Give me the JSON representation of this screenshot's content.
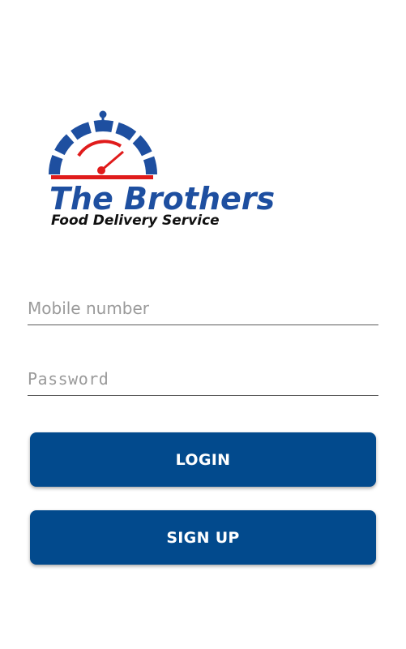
{
  "logo": {
    "title": "The Brothers",
    "tagline": "Food Delivery Service",
    "primary_color": "#1e4fa0",
    "accent_color": "#e01b1b",
    "icon": "speedometer-icon"
  },
  "form": {
    "mobile_placeholder": "Mobile number",
    "password_placeholder": "Password"
  },
  "actions": {
    "login_label": "LOGIN",
    "signup_label": "SIGN UP",
    "button_color": "#024a8d"
  }
}
